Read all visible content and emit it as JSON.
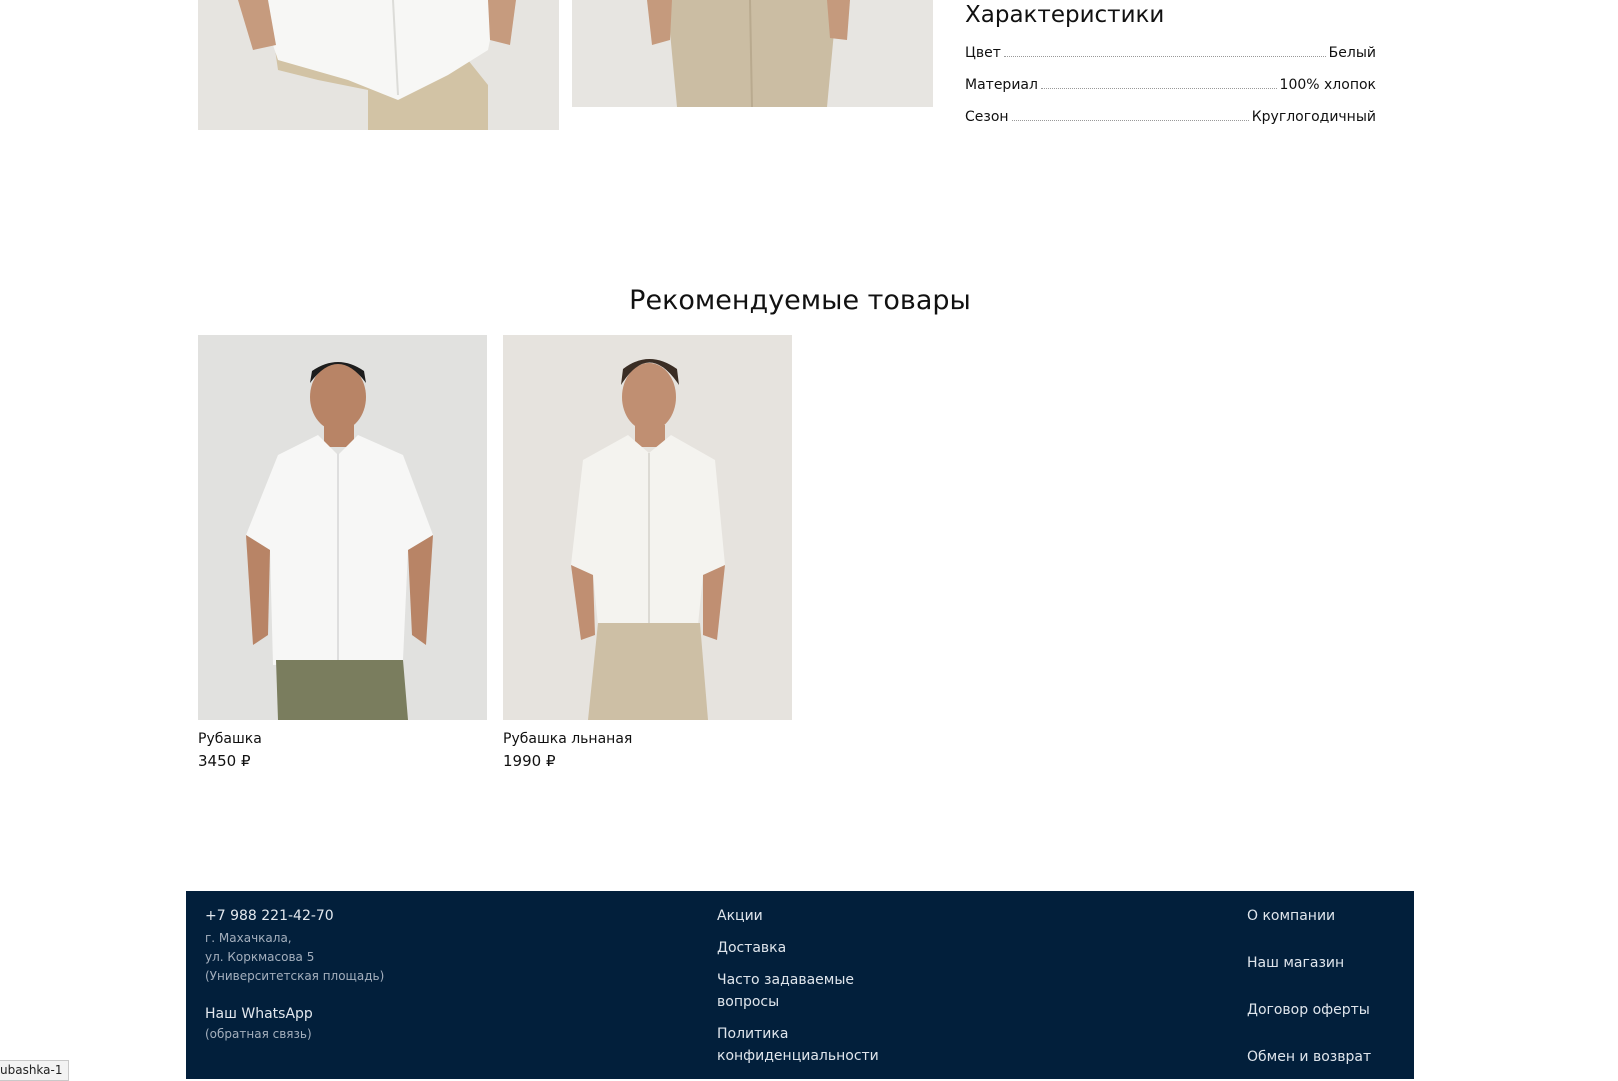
{
  "characteristics": {
    "title": "Характеристики",
    "rows": [
      {
        "label": "Цвет",
        "value": "Белый"
      },
      {
        "label": "Материал",
        "value": "100% хлопок"
      },
      {
        "label": "Сезон",
        "value": "Круглогодичный"
      }
    ]
  },
  "recommended": {
    "title": "Рекомендуемые товары",
    "products": [
      {
        "name": "Рубашка",
        "price": "3450 ₽"
      },
      {
        "name": "Рубашка льнаная",
        "price": "1990 ₽"
      }
    ]
  },
  "footer": {
    "phone": "+7 988 221-42-70",
    "address_lines": [
      "г. Махачкала,",
      "ул. Коркмасова 5",
      "(Университетская площадь)"
    ],
    "whatsapp": "Наш WhatsApp",
    "whatsapp_sub": "(обратная связь)",
    "col2": [
      "Акции",
      "Доставка",
      "Часто задаваемые вопросы",
      "Политика конфиденциальности"
    ],
    "col3": [
      "О компании",
      "Наш магазин",
      "Договор оферты",
      "Обмен и возврат"
    ]
  },
  "status_chip": "ubashka-1",
  "colors": {
    "footer_bg": "#021f3b",
    "page_bg": "#ffffff"
  }
}
